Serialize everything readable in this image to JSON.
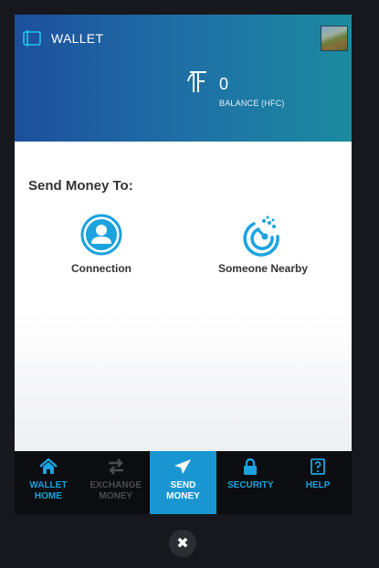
{
  "header": {
    "title": "WALLET",
    "balance_value": "0",
    "balance_label": "BALANCE (HFC)"
  },
  "main": {
    "heading": "Send Money To:",
    "options": [
      {
        "label": "Connection",
        "icon": "person-icon"
      },
      {
        "label": "Someone Nearby",
        "icon": "radar-icon"
      }
    ]
  },
  "tabs": [
    {
      "line1": "WALLET",
      "line2": "HOME",
      "icon": "home-icon",
      "state": "enabled"
    },
    {
      "line1": "EXCHANGE",
      "line2": "MONEY",
      "icon": "exchange-arrows-icon",
      "state": "disabled"
    },
    {
      "line1": "SEND",
      "line2": "MONEY",
      "icon": "send-plane-icon",
      "state": "active"
    },
    {
      "line1": "SECURITY",
      "line2": "",
      "icon": "lock-icon",
      "state": "enabled"
    },
    {
      "line1": "HELP",
      "line2": "",
      "icon": "help-icon",
      "state": "enabled"
    }
  ],
  "colors": {
    "accent": "#1aa3de",
    "active_tab": "#1996d2",
    "header_start": "#1d4f9c",
    "header_end": "#1b8aa0"
  },
  "close_icon": "close-icon"
}
